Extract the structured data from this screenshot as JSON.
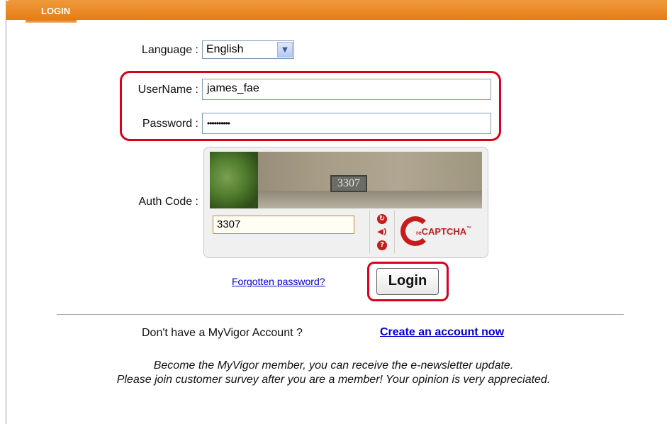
{
  "header": {
    "title": "LOGIN"
  },
  "form": {
    "language_label": "Language :",
    "language_value": "English",
    "username_label": "UserName :",
    "username_value": "james_fae",
    "password_label": "Password :",
    "password_value": "••••••••••",
    "authcode_label": "Auth Code :"
  },
  "captcha": {
    "image_text": "3307",
    "input_value": "3307",
    "logo_prefix": "re",
    "logo_text": "CAPTCHA",
    "logo_tm": "™",
    "icons": [
      "refresh-icon",
      "audio-icon",
      "help-icon"
    ]
  },
  "actions": {
    "forgot_label": "Forgotten password?",
    "login_label": "Login"
  },
  "signup": {
    "question": "Don't have a MyVigor Account ?",
    "create_label": "Create an account now",
    "line1": "Become the MyVigor member, you can receive the e-newsletter update.",
    "line2": "Please join customer survey after you are a member! Your opinion is very appreciated."
  },
  "colors": {
    "header": "#e57d16",
    "highlight": "#d9001b",
    "link": "#0000cc",
    "captcha": "#c61c1c"
  }
}
